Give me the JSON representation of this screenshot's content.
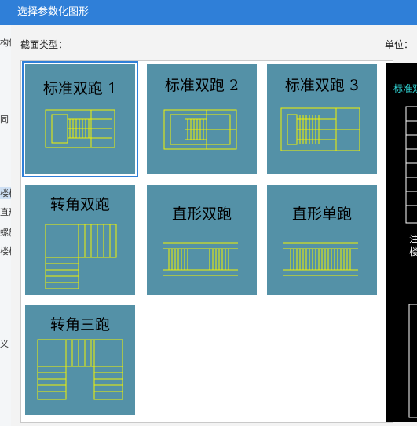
{
  "dialog": {
    "title": "选择参数化图形",
    "section_type_label": "截面类型：",
    "unit_label": "单位："
  },
  "background_fragments": [
    "构件",
    "同",
    "楼梯",
    "直形",
    "螺旋",
    "楼梯",
    "义"
  ],
  "shapes": [
    {
      "name": "标准双跑 1",
      "icon": "stair-standard-double-1-icon",
      "selected": true
    },
    {
      "name": "标准双跑 2",
      "icon": "stair-standard-double-2-icon",
      "selected": false
    },
    {
      "name": "标准双跑 3",
      "icon": "stair-standard-double-3-icon",
      "selected": false
    },
    {
      "name": "转角双跑",
      "icon": "stair-corner-double-icon",
      "selected": false
    },
    {
      "name": "直形双跑",
      "icon": "stair-straight-double-icon",
      "selected": false
    },
    {
      "name": "直形单跑",
      "icon": "stair-straight-single-icon",
      "selected": false
    },
    {
      "name": "转角三跑",
      "icon": "stair-corner-triple-icon",
      "selected": false
    }
  ],
  "preview": {
    "title_fragment": "标准双",
    "text_fragments": [
      "注",
      "楼"
    ]
  },
  "colors": {
    "titlebar": "#2f7fd8",
    "cell_fill": "#5491a7",
    "stair_lines": "#f2f200",
    "preview_bg": "#000000",
    "preview_title": "#2fd0d0"
  }
}
